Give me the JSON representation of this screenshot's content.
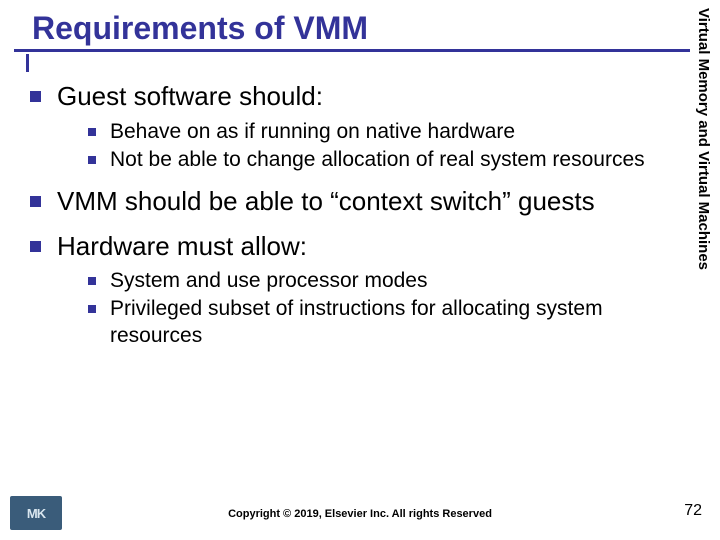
{
  "title": "Requirements of VMM",
  "sidebar_label": "Virtual Memory and Virtual Machines",
  "bullets": {
    "item1": "Guest software should:",
    "item1_sub1": "Behave on as if running on native hardware",
    "item1_sub2": "Not be able to change allocation of real system resources",
    "item2": "VMM should be able to “context switch” guests",
    "item3": "Hardware must allow:",
    "item3_sub1": "System and use processor modes",
    "item3_sub2": "Privileged subset of instructions for allocating system resources"
  },
  "footer": {
    "copyright": "Copyright © 2019, Elsevier Inc. All rights Reserved",
    "page_number": "72",
    "logo_text": "MK"
  }
}
